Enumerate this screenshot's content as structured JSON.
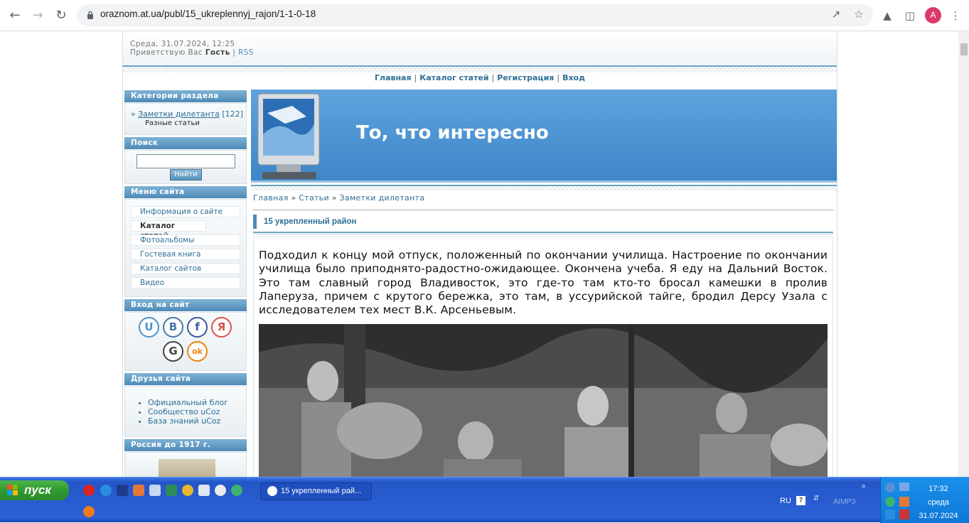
{
  "browser": {
    "url": "oraznom.at.ua/publ/15_ukreplennyj_rajon/1-1-0-18",
    "avatar_letter": "A",
    "icons": [
      "back-icon",
      "forward-icon",
      "reload-icon",
      "lock-icon",
      "share-icon",
      "star-icon",
      "labs-icon",
      "side-panel-icon",
      "profile-avatar",
      "more-icon"
    ]
  },
  "site": {
    "date": "Среда, 31.07.2024, 12:25",
    "greeting_prefix": "Приветствую Вас",
    "greeting_user": "Гость",
    "sep": "|",
    "rss": "RSS",
    "top_menu": [
      "Главная",
      "Каталог статей",
      "Регистрация",
      "Вход"
    ],
    "title": "То, что интересно"
  },
  "sidebar": {
    "categories_title": "Категории раздела",
    "category_link": "Заметки дилетанта",
    "category_count": "[122]",
    "category_desc": "Разные статьи",
    "search_title": "Поиск",
    "search_button": "Найти",
    "menu_title": "Меню сайта",
    "menu_items": [
      "Информация о сайте",
      "Каталог статей",
      "Фотоальбомы",
      "Гостевая книга",
      "Каталог сайтов",
      "Видео"
    ],
    "login_title": "Вход на сайт",
    "social": [
      "U",
      "В",
      "f",
      "Я",
      "G",
      "ok"
    ],
    "friends_title": "Друзья сайта",
    "friends": [
      "Официальный блог",
      "Сообщество uCoz",
      "База знаний uCoz"
    ],
    "russia_title": "Россия до 1917 г."
  },
  "content": {
    "crumbs": [
      "Главная",
      "Статьи",
      "Заметки дилетанта"
    ],
    "crumb_sep": "»",
    "article_title": "15 укрепленный район",
    "article_text": "Подходил к концу мой отпуск, положенный по окончании училища. Настроение по окончании училища было приподнято-радостно-ожидающее. Окончена учеба. Я еду на Дальний Восток. Это там славный город Владивосток, это где-то там кто-то бросал камешки в пролив Лаперуза, причем с крутого бережка, это там, в уссурийской тайге, бродил Дерсу Узала с исследователем тех мест В.К. Арсеньевым."
  },
  "taskbar": {
    "start": "пуск",
    "task_window": "15 укрепленный рай...",
    "lang": "RU",
    "aimp": "AIMP3",
    "time": "17:32",
    "day": "среда",
    "date": "31.07.2024",
    "chevron": "»"
  }
}
